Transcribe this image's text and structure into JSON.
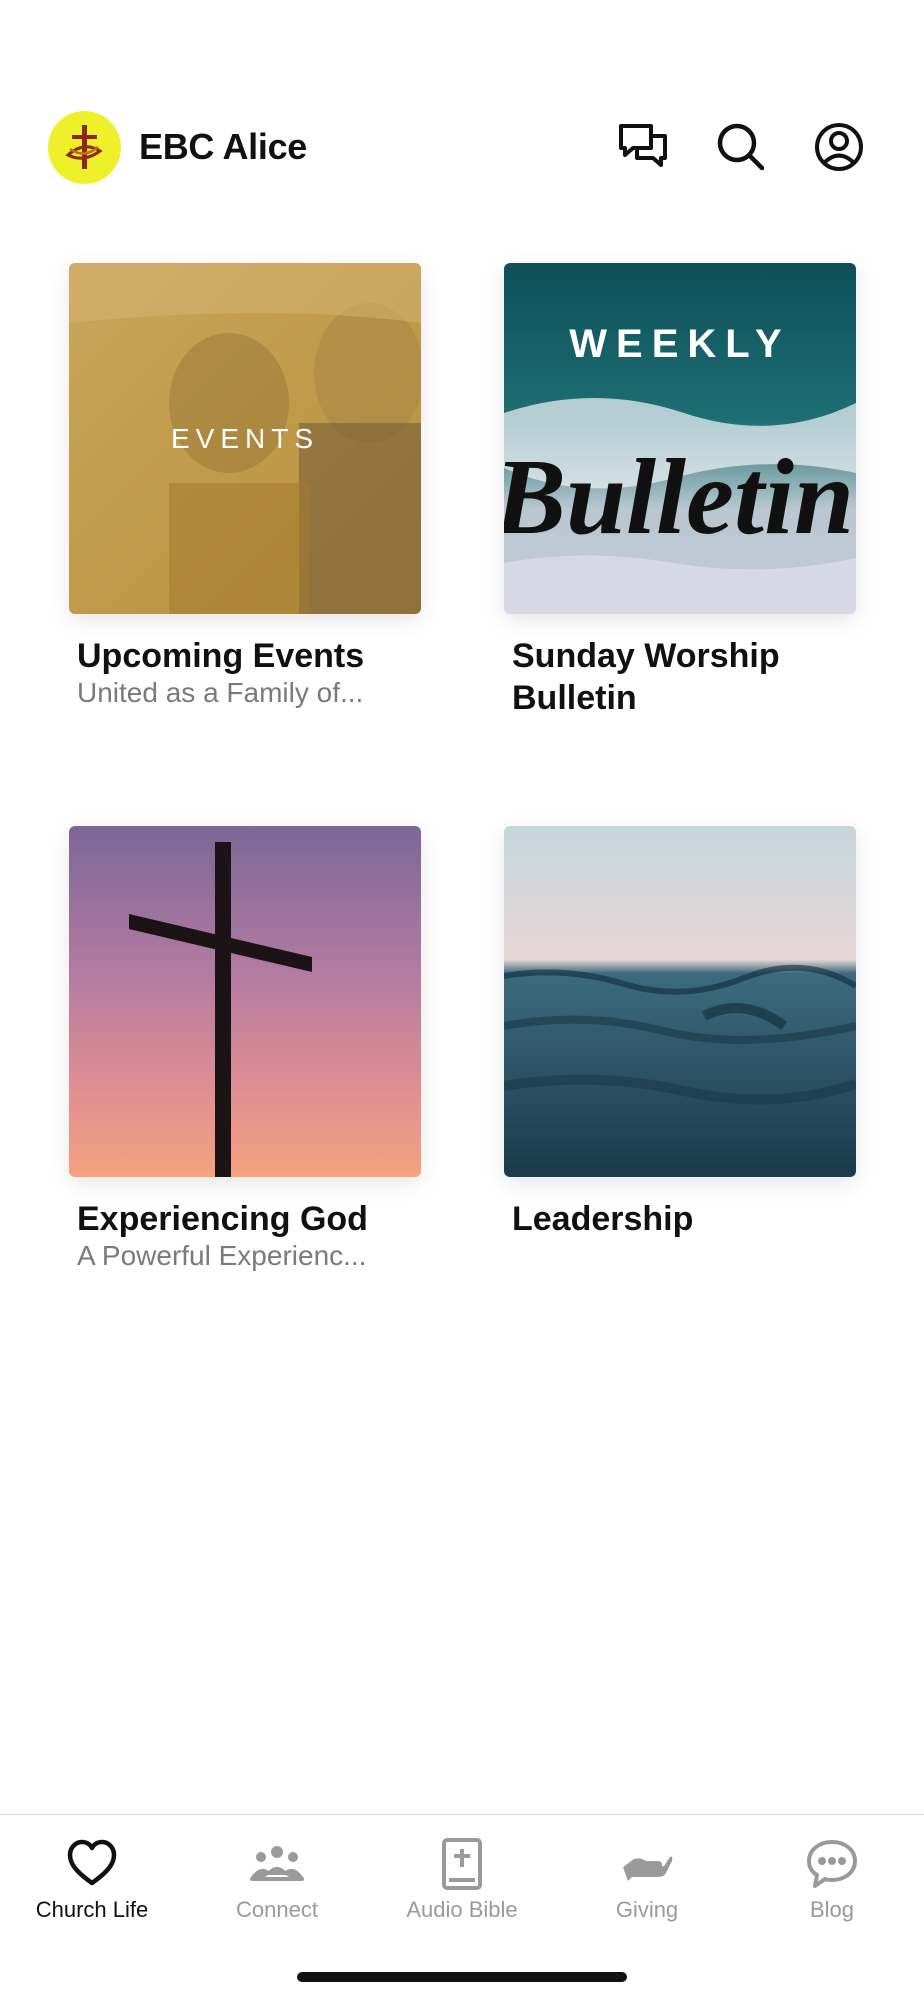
{
  "header": {
    "app_name": "EBC Alice",
    "logo_color": "#eef02a",
    "icons": [
      "chat-icon",
      "search-icon",
      "account-icon"
    ]
  },
  "cards": [
    {
      "title": "Upcoming Events",
      "subtitle": "United as a Family of...",
      "image_text": "EVENTS"
    },
    {
      "title": "Sunday Worship Bulletin",
      "subtitle": "",
      "image_text_top": "WEEKLY",
      "image_text_script": "Bulletin"
    },
    {
      "title": "Experiencing God",
      "subtitle": "A Powerful Experienc..."
    },
    {
      "title": "Leadership",
      "subtitle": ""
    }
  ],
  "tabbar": {
    "active_color": "#111111",
    "inactive_color": "#9a9a9a",
    "tabs": [
      {
        "label": "Church Life",
        "icon": "heart-icon",
        "active": true
      },
      {
        "label": "Connect",
        "icon": "people-icon",
        "active": false
      },
      {
        "label": "Audio Bible",
        "icon": "bible-icon",
        "active": false
      },
      {
        "label": "Giving",
        "icon": "giving-hand-icon",
        "active": false
      },
      {
        "label": "Blog",
        "icon": "speech-bubble-icon",
        "active": false
      }
    ]
  }
}
